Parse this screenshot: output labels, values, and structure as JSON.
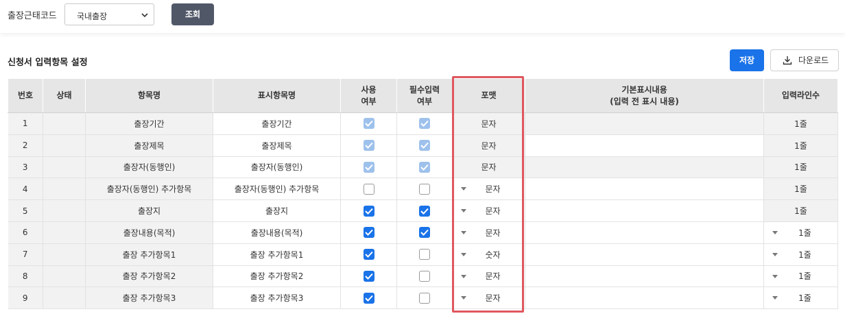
{
  "filter": {
    "label": "출장근태코드",
    "selected": "국내출장",
    "search_button": "조회"
  },
  "section": {
    "title": "신청서 입력항목 설정",
    "save_button": "저장",
    "download_button": "다운로드"
  },
  "table": {
    "headers": {
      "no": "번호",
      "status": "상태",
      "item_name": "항목명",
      "display_name": "표시항목명",
      "use_line1": "사용",
      "use_line2": "여부",
      "req_line1": "필수입력",
      "req_line2": "여부",
      "format": "포맷",
      "default_line1": "기본표시내용",
      "default_line2": "(입력 전 표시 내용)",
      "lines": "입력라인수"
    },
    "rows": [
      {
        "no": "1",
        "status": "",
        "item_name": "출장기간",
        "display_name": "출장기간",
        "use": "disabled-checked",
        "required": "disabled-checked",
        "format": "문자",
        "format_dropdown": false,
        "default_text": "",
        "default_editable": false,
        "lines": "1줄",
        "lines_dropdown": false
      },
      {
        "no": "2",
        "status": "",
        "item_name": "출장제목",
        "display_name": "출장제목",
        "use": "disabled-checked",
        "required": "disabled-checked",
        "format": "문자",
        "format_dropdown": false,
        "default_text": "",
        "default_editable": true,
        "lines": "1줄",
        "lines_dropdown": false
      },
      {
        "no": "3",
        "status": "",
        "item_name": "출장자(동행인)",
        "display_name": "출장자(동행인)",
        "use": "disabled-checked",
        "required": "disabled-checked",
        "format": "문자",
        "format_dropdown": false,
        "default_text": "",
        "default_editable": false,
        "lines": "1줄",
        "lines_dropdown": false
      },
      {
        "no": "4",
        "status": "",
        "item_name": "출장자(동행인) 추가항목",
        "display_name": "출장자(동행인) 추가항목",
        "use": "unchecked",
        "required": "unchecked",
        "format": "문자",
        "format_dropdown": true,
        "default_text": "",
        "default_editable": true,
        "lines": "1줄",
        "lines_dropdown": false
      },
      {
        "no": "5",
        "status": "",
        "item_name": "출장지",
        "display_name": "출장지",
        "use": "checked",
        "required": "checked",
        "format": "문자",
        "format_dropdown": true,
        "default_text": "",
        "default_editable": true,
        "lines": "1줄",
        "lines_dropdown": false
      },
      {
        "no": "6",
        "status": "",
        "item_name": "출장내용(목적)",
        "display_name": "출장내용(목적)",
        "use": "checked",
        "required": "checked",
        "format": "문자",
        "format_dropdown": true,
        "default_text": "",
        "default_editable": true,
        "lines": "1줄",
        "lines_dropdown": true
      },
      {
        "no": "7",
        "status": "",
        "item_name": "출장 추가항목1",
        "display_name": "출장 추가항목1",
        "use": "checked",
        "required": "unchecked",
        "format": "숫자",
        "format_dropdown": true,
        "default_text": "",
        "default_editable": true,
        "lines": "1줄",
        "lines_dropdown": true
      },
      {
        "no": "8",
        "status": "",
        "item_name": "출장 추가항목2",
        "display_name": "출장 추가항목2",
        "use": "checked",
        "required": "unchecked",
        "format": "문자",
        "format_dropdown": true,
        "default_text": "",
        "default_editable": true,
        "lines": "1줄",
        "lines_dropdown": true
      },
      {
        "no": "9",
        "status": "",
        "item_name": "출장 추가항목3",
        "display_name": "출장 추가항목3",
        "use": "checked",
        "required": "unchecked",
        "format": "문자",
        "format_dropdown": true,
        "default_text": "",
        "default_editable": true,
        "lines": "1줄",
        "lines_dropdown": true
      }
    ]
  },
  "colors": {
    "accent": "#1a73e8",
    "highlight_border": "#e0575f",
    "header_bg": "#e6e6e6",
    "search_button_bg": "#505868"
  }
}
